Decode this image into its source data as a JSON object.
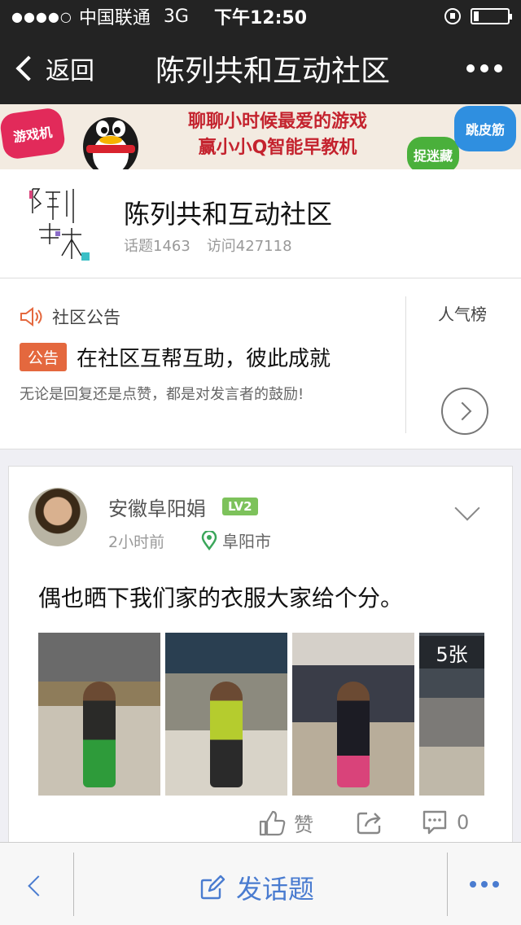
{
  "status_bar": {
    "signal": "●●●●○",
    "carrier": "中国联通",
    "network": "3G",
    "time": "下午12:50",
    "battery_level": 0.15
  },
  "nav": {
    "back_label": "返回",
    "title": "陈列共和互动社区"
  },
  "banner": {
    "line1": "聊聊小时候最爱的游戏",
    "line2": "赢小小Q智能早教机",
    "bubble_left": "游戏机",
    "bubble_right": "跳皮筋",
    "bubble_bottom": "捉迷藏"
  },
  "community": {
    "name": "陈列共和互动社区",
    "topics": "话题1463",
    "visits": "访问427118"
  },
  "notice": {
    "section_label": "社区公告",
    "tag": "公告",
    "headline": "在社区互帮互助，彼此成就",
    "description": "无论是回复还是点赞，都是对发言者的鼓励!",
    "rank_label": "人气榜"
  },
  "post": {
    "author": "安徽阜阳娟",
    "level": "LV2",
    "time": "2小时前",
    "location": "阜阳市",
    "content": "偶也晒下我们家的衣服大家给个分。",
    "photo_count_label": "5张",
    "like_label": "赞",
    "comment_count": "0"
  },
  "bottom_bar": {
    "post_topic_label": "发话题"
  },
  "colors": {
    "accent_blue": "#4a7cd0",
    "notice_tag": "#e4683e",
    "level_badge": "#7dc25b",
    "nav_bg": "#232323"
  },
  "icons": {
    "speaker": "speaker-icon",
    "location": "location-pin-icon",
    "like": "thumbs-up-icon",
    "share": "share-icon",
    "comment": "comment-icon",
    "edit": "edit-icon"
  }
}
